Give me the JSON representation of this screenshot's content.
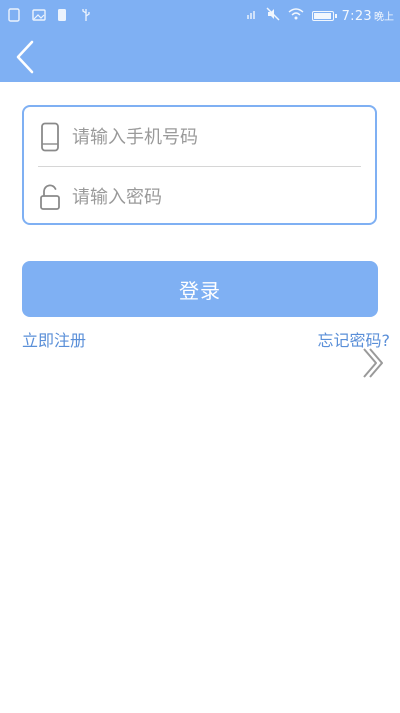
{
  "status_bar": {
    "time": "7:23",
    "ampm": "晚上"
  },
  "nav": {
    "back_icon": "chevron-left-icon"
  },
  "form": {
    "phone_placeholder": "请输入手机号码",
    "phone_value": "",
    "phone_icon": "phone-icon",
    "password_placeholder": "请输入密码",
    "password_value": "",
    "password_icon": "lock-icon"
  },
  "actions": {
    "login_label": "登录",
    "register_label": "立即注册",
    "forgot_label": "忘记密码?"
  },
  "colors": {
    "primary": "#7fb0f3",
    "link": "#5a8fd8",
    "border": "#7fb0f3",
    "divider": "#d6d6d6",
    "placeholder": "#9a9a9a"
  }
}
